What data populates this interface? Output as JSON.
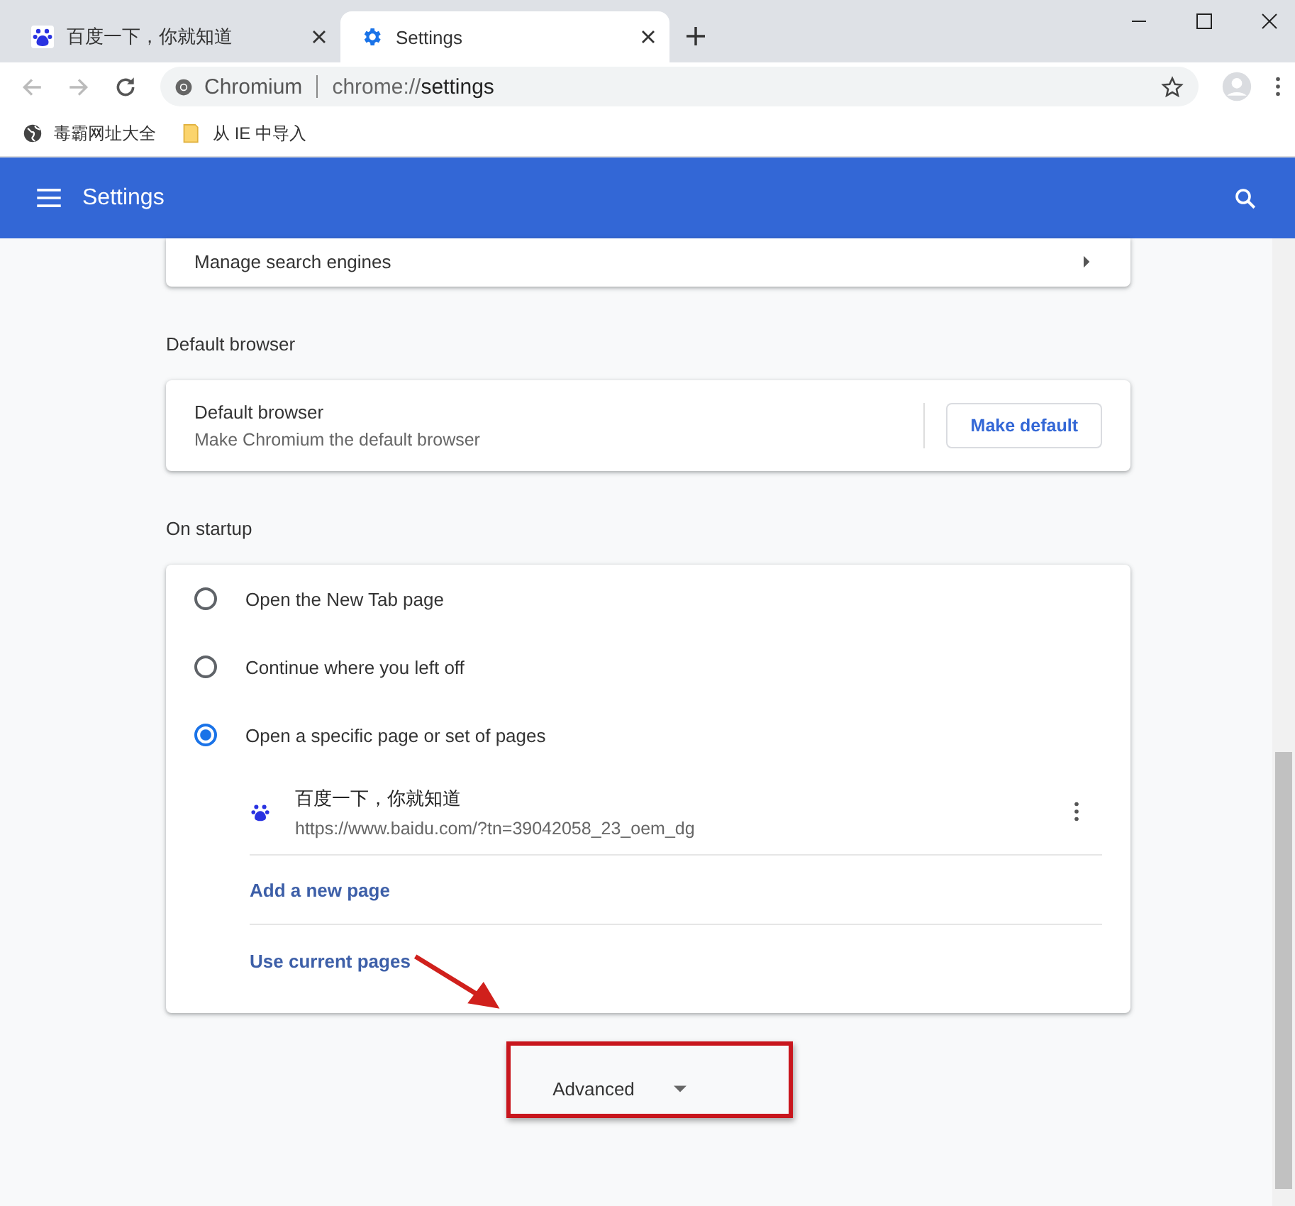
{
  "tabs": [
    {
      "title": "百度一下，你就知道",
      "kind": "paw",
      "selected": false
    },
    {
      "title": "Settings",
      "kind": "gear",
      "selected": true
    }
  ],
  "toolbar": {
    "site_name": "Chromium",
    "url_scheme": "chrome://",
    "url_path": "settings"
  },
  "bookmarks": [
    {
      "label": "毒霸网址大全",
      "kind": "globe"
    },
    {
      "label": "从 IE 中导入",
      "kind": "folder"
    }
  ],
  "header": {
    "title": "Settings"
  },
  "search_engines": {
    "label": "Manage search engines"
  },
  "default_browser": {
    "heading": "Default browser",
    "title": "Default browser",
    "subtitle": "Make Chromium the default browser",
    "button": "Make default"
  },
  "startup": {
    "heading": "On startup",
    "options": [
      {
        "label": "Open the New Tab page",
        "selected": false
      },
      {
        "label": "Continue where you left off",
        "selected": false
      },
      {
        "label": "Open a specific page or set of pages",
        "selected": true
      }
    ],
    "pages": [
      {
        "title": "百度一下，你就知道",
        "url": "https://www.baidu.com/?tn=39042058_23_oem_dg"
      }
    ],
    "links": [
      "Add a new page",
      "Use current pages"
    ]
  },
  "advanced": {
    "label": "Advanced"
  }
}
